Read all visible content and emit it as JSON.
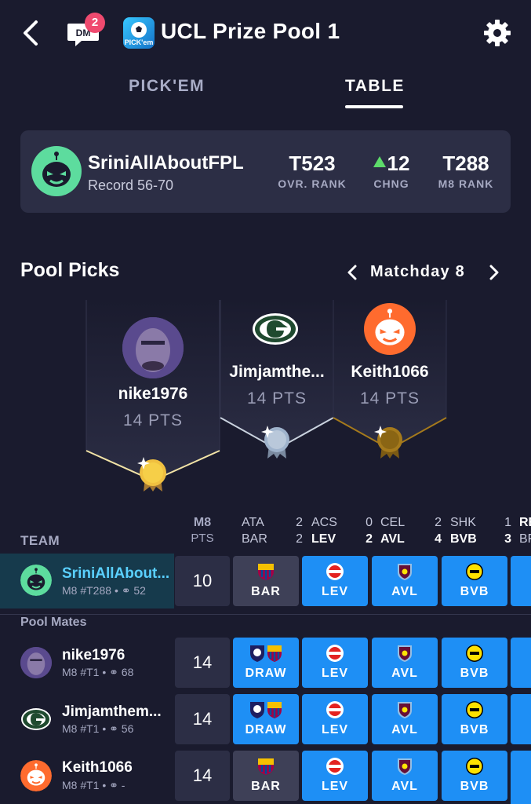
{
  "header": {
    "title": "UCL Prize Pool 1",
    "dm_label": "DM",
    "dm_badge": "2",
    "app_logo_text": "PICK'em"
  },
  "tabs": [
    {
      "label": "PICK'EM",
      "active": false
    },
    {
      "label": "TABLE",
      "active": true
    }
  ],
  "profile": {
    "name": "SriniAllAboutFPL",
    "record": "Record 56-70",
    "stats": [
      {
        "value": "T523",
        "label": "OVR. RANK"
      },
      {
        "value": "12",
        "label": "CHNG",
        "direction": "up"
      },
      {
        "value": "T288",
        "label": "M8 RANK"
      }
    ]
  },
  "pool_picks": {
    "title": "Pool Picks",
    "matchday": "Matchday 8",
    "podium": [
      {
        "name": "nike1976",
        "pts": "14 PTS",
        "medal": "gold"
      },
      {
        "name": "Jimjamthe...",
        "pts": "14 PTS",
        "medal": "silver"
      },
      {
        "name": "Keith1066",
        "pts": "14 PTS",
        "medal": "bronze"
      }
    ]
  },
  "table": {
    "team_header": "TEAM",
    "pts_header": "M8",
    "pts_subheader": "PTS",
    "matches": [
      {
        "home": "ATA",
        "home_score": "2",
        "away": "BAR",
        "away_score": "2",
        "bold": false
      },
      {
        "home": "ACS",
        "home_score": "0",
        "away": "LEV",
        "away_score": "2",
        "bold": true
      },
      {
        "home": "CEL",
        "home_score": "2",
        "away": "AVL",
        "away_score": "4",
        "bold": true
      },
      {
        "home": "SHK",
        "home_score": "1",
        "away": "BVB",
        "away_score": "3",
        "bold": true
      },
      {
        "home": "RE",
        "home_score": "",
        "away": "BF",
        "away_score": "",
        "bold": false
      }
    ],
    "my_row": {
      "name": "SriniAllAbout...",
      "rank": "M8 #T288",
      "coins": "52",
      "pts": "10",
      "picks": [
        "BAR",
        "LEV",
        "AVL",
        "BVB"
      ]
    },
    "pool_mates_label": "Pool Mates",
    "mates": [
      {
        "name": "nike1976",
        "rank": "M8 #T1",
        "coins": "68",
        "pts": "14",
        "picks": [
          "DRAW",
          "LEV",
          "AVL",
          "BVB"
        ]
      },
      {
        "name": "Jimjamthem...",
        "rank": "M8 #T1",
        "coins": "56",
        "pts": "14",
        "picks": [
          "DRAW",
          "LEV",
          "AVL",
          "BVB"
        ]
      },
      {
        "name": "Keith1066",
        "rank": "M8 #T1",
        "coins": "-",
        "pts": "14",
        "picks": [
          "BAR",
          "LEV",
          "AVL",
          "BVB"
        ]
      }
    ]
  },
  "colors": {
    "background": "#1a1b2e",
    "card": "#2c2e45",
    "pick_blue": "#1e8ff5",
    "pick_grey": "#3e4057",
    "highlight_row": "#163a4c",
    "my_name": "#5ad0ff",
    "gold": "#f0c040",
    "silver": "#9fb3cc",
    "bronze": "#a57a1c"
  }
}
